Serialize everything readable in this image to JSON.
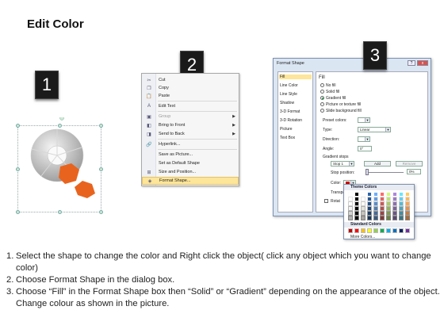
{
  "page": {
    "title": "Edit Color"
  },
  "steps": {
    "one": "1",
    "two": "2",
    "three": "3"
  },
  "context_menu": {
    "items": [
      {
        "label": "Cut",
        "icon": "scissors-icon",
        "disabled": false,
        "submenu": false
      },
      {
        "label": "Copy",
        "icon": "copy-icon",
        "disabled": false,
        "submenu": false
      },
      {
        "label": "Paste",
        "icon": "paste-icon",
        "disabled": false,
        "submenu": false
      },
      {
        "label": "Edit Text",
        "icon": "edit-text-icon",
        "disabled": false,
        "submenu": false
      },
      {
        "label": "Group",
        "icon": "group-icon",
        "disabled": true,
        "submenu": true
      },
      {
        "label": "Bring to Front",
        "icon": "bring-front-icon",
        "disabled": false,
        "submenu": true
      },
      {
        "label": "Send to Back",
        "icon": "send-back-icon",
        "disabled": false,
        "submenu": true
      },
      {
        "label": "Hyperlink...",
        "icon": "hyperlink-icon",
        "disabled": false,
        "submenu": false
      },
      {
        "label": "Save as Picture...",
        "icon": "",
        "disabled": false,
        "submenu": false
      },
      {
        "label": "Set as Default Shape",
        "icon": "",
        "disabled": false,
        "submenu": false
      },
      {
        "label": "Size and Position...",
        "icon": "size-icon",
        "disabled": false,
        "submenu": false
      },
      {
        "label": "Format Shape...",
        "icon": "format-shape-icon",
        "disabled": false,
        "submenu": false,
        "highlight": true
      }
    ]
  },
  "dialog": {
    "title": "Format Shape",
    "close": "x",
    "nav": [
      "Fill",
      "Line Color",
      "Line Style",
      "Shadow",
      "3-D Format",
      "3-D Rotation",
      "Picture",
      "Text Box"
    ],
    "fill_heading": "Fill",
    "options": [
      "No fill",
      "Solid fill",
      "Gradient fill",
      "Picture or texture fill",
      "Slide background fill"
    ],
    "selected_option": "Gradient fill",
    "preset_colors_label": "Preset colors:",
    "type_label": "Type:",
    "type_value": "Linear",
    "direction_label": "Direction:",
    "angle_label": "Angle:",
    "angle_value": "0°",
    "gradient_stops_label": "Gradient stops",
    "stop_value": "Stop 1",
    "add_button": "Add",
    "remove_button": "Remove",
    "stop_position_label": "Stop position:",
    "stop_position_value": "0%",
    "color_label": "Color:",
    "transparency_label": "Transpa",
    "rotate_label": "Rotat",
    "theme_colors": "Theme Colors",
    "standard_colors": "Standard Colors",
    "more_colors": "More Colors..."
  },
  "instructions": [
    {
      "num": "1.",
      "text": "Select the shape to change the color and Right click the object( click any object which you want to change color)"
    },
    {
      "num": "2.",
      "text": "Choose Format Shape in the dialog box."
    },
    {
      "num": "3.",
      "text": "Choose “Fill” in the Format Shape box then “Solid” or “Gradient” depending on the appearance of the object. Change colour as shown in the picture."
    }
  ],
  "colors": {
    "highlight": "#fde59a",
    "accent_orange": "#e8641e",
    "dialog_bg": "#dbe6f3"
  }
}
